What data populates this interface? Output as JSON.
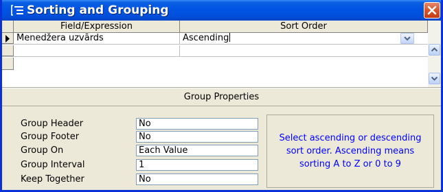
{
  "window": {
    "title": "Sorting and Grouping",
    "title_icon": "sorting-grouping-icon",
    "close_icon": "close-icon"
  },
  "grid": {
    "columns": [
      "Field/Expression",
      "Sort Order"
    ],
    "rows": [
      {
        "field": "Menedžera uzvārds",
        "sort_order": "Ascending",
        "current": true
      },
      {
        "field": "",
        "sort_order": "",
        "current": false
      }
    ]
  },
  "group_properties": {
    "title": "Group Properties",
    "properties": [
      {
        "label": "Group Header",
        "value": "No"
      },
      {
        "label": "Group Footer",
        "value": "No"
      },
      {
        "label": "Group On",
        "value": "Each Value"
      },
      {
        "label": "Group Interval",
        "value": "1"
      },
      {
        "label": "Keep Together",
        "value": "No"
      }
    ],
    "help_text": "Select ascending or descending sort order.  Ascending means sorting A to Z or 0 to 9"
  },
  "colors": {
    "title_bar": "#0054e3",
    "help_text": "#0000ff",
    "dialog_bg": "#ece9d8"
  }
}
